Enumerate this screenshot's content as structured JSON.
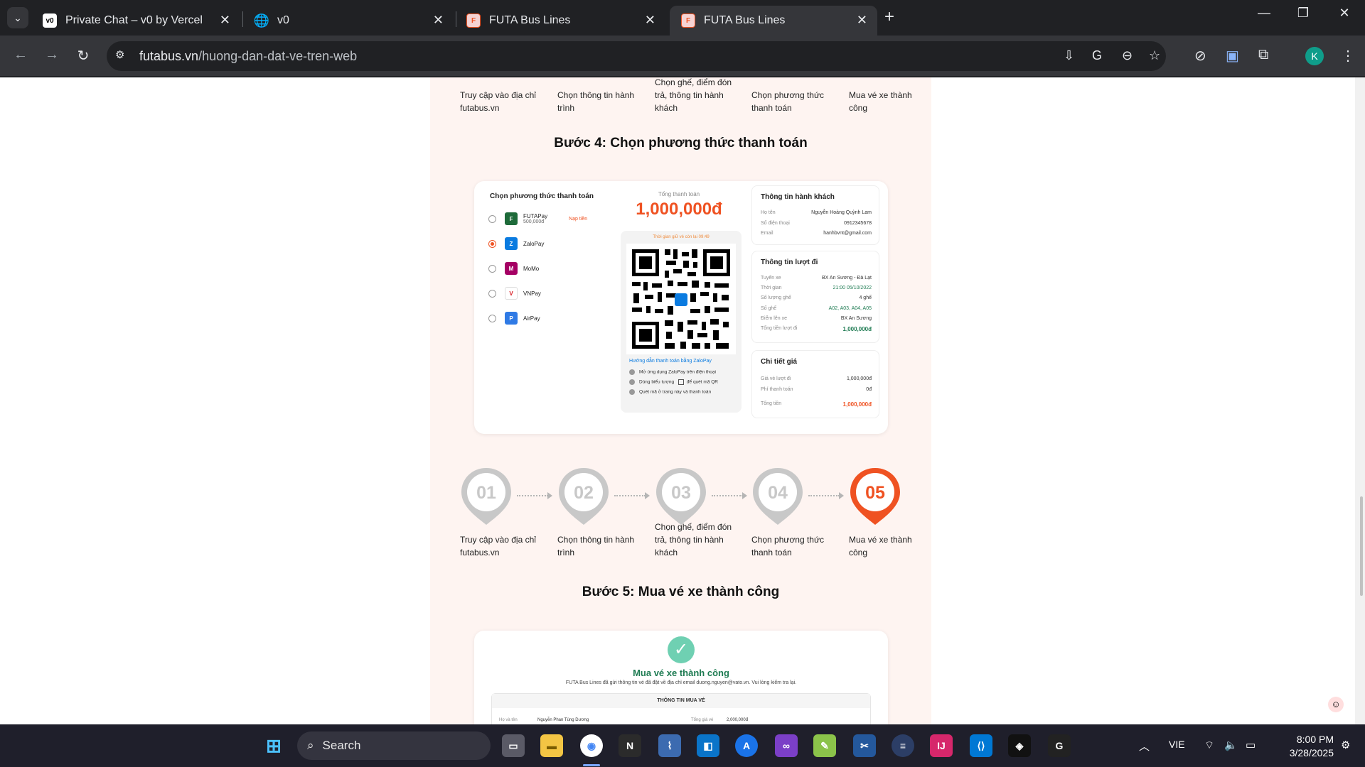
{
  "browser": {
    "tabs": [
      {
        "title": "Private Chat – v0 by Vercel",
        "favicon": "v0-icon"
      },
      {
        "title": "v0",
        "favicon": "globe-icon"
      },
      {
        "title": "FUTA Bus Lines",
        "favicon": "futa-icon"
      },
      {
        "title": "FUTA Bus Lines",
        "favicon": "futa-icon",
        "active": true
      }
    ],
    "url_host": "futabus.vn",
    "url_path": "/huong-dan-dat-ve-tren-web",
    "profile_initial": "K"
  },
  "page": {
    "top_steps": [
      {
        "label": "Truy cập vào địa chỉ futabus.vn"
      },
      {
        "label": "Chọn thông tin hành trình"
      },
      {
        "label": "Chọn ghế, điểm đón trả, thông tin hành khách"
      },
      {
        "label": "Chọn phương thức thanh toán"
      },
      {
        "label": "Mua vé xe thành công"
      }
    ],
    "step4_heading": "Bước 4: Chọn phương thức thanh toán",
    "payment": {
      "title": "Chọn phương thức thanh toán",
      "methods": [
        {
          "name": "FUTAPay",
          "sub": "500,000đ",
          "extra": "Nạp tiền",
          "color": "#1e6b3a",
          "icon": "futapay-icon",
          "selected": false
        },
        {
          "name": "ZaloPay",
          "color": "#0a7be0",
          "icon": "zalopay-icon",
          "selected": true
        },
        {
          "name": "MoMo",
          "color": "#a50064",
          "icon": "momo-icon",
          "selected": false
        },
        {
          "name": "VNPay",
          "color": "#d71920",
          "icon": "vnpay-icon",
          "selected": false
        },
        {
          "name": "AirPay",
          "color": "#2f7ae5",
          "icon": "airpay-icon",
          "selected": false
        }
      ],
      "total_label": "Tổng thanh toán",
      "total_value": "1,000,000đ",
      "countdown": "Thời gian giữ vé còn lại 09:49",
      "guide_title": "Hướng dẫn thanh toán bằng ZaloPay",
      "guide_steps": [
        "Mở ứng dụng ZaloPay trên điện thoại",
        "Dùng biểu tượng",
        "để quét mã QR",
        "Quét mã ở trang này và thanh toán"
      ],
      "passenger": {
        "title": "Thông tin hành khách",
        "rows": [
          {
            "k": "Họ tên",
            "v": "Nguyễn Hoàng Quỳnh Lam"
          },
          {
            "k": "Số điện thoại",
            "v": "0912345678"
          },
          {
            "k": "Email",
            "v": "hanhbvnt@gmail.com"
          }
        ]
      },
      "trip": {
        "title": "Thông tin lượt đi",
        "rows": [
          {
            "k": "Tuyến xe",
            "v": "BX An Sương - Đà Lạt"
          },
          {
            "k": "Thời gian",
            "v": "21:00 05/10/2022"
          },
          {
            "k": "Số lượng ghế",
            "v": "4 ghế"
          },
          {
            "k": "Số ghế",
            "v": "A02, A03, A04, A05"
          },
          {
            "k": "Điểm lên xe",
            "v": "BX An Sương"
          },
          {
            "k": "Tổng tiền lượt đi",
            "v": "1,000,000đ"
          }
        ]
      },
      "price": {
        "title": "Chi tiết giá",
        "rows": [
          {
            "k": "Giá vé lượt đi",
            "v": "1,000,000đ"
          },
          {
            "k": "Phí thanh toán",
            "v": "0đ"
          },
          {
            "k": "Tổng tiền",
            "v": "1,000,000đ"
          }
        ]
      }
    },
    "steps": [
      {
        "num": "01",
        "label": "Truy cập vào địa chỉ futabus.vn",
        "active": false
      },
      {
        "num": "02",
        "label": "Chọn thông tin hành trình",
        "active": false
      },
      {
        "num": "03",
        "label": "Chọn ghế, điểm đón trả, thông tin hành khách",
        "active": false
      },
      {
        "num": "04",
        "label": "Chọn phương thức thanh toán",
        "active": false
      },
      {
        "num": "05",
        "label": "Mua vé xe thành công",
        "active": true
      }
    ],
    "step5_heading": "Bước 5: Mua vé xe thành công",
    "success": {
      "title": "Mua vé xe thành công",
      "message": "FUTA Bus Lines đã gửi thông tin vé đã đặt về địa chỉ email duong.nguyen@vato.vn. Vui lòng kiểm tra lại.",
      "section_title": "THÔNG TIN MUA VÉ",
      "row_left_key": "Họ và tên",
      "row_left_value": "Nguyễn Phan Tùng Dương",
      "row_right_key": "Tổng giá vé",
      "row_right_value": "2,000,000đ"
    },
    "colors": {
      "accent": "#ef5222",
      "inactive_pin": "#c8c8c8",
      "success_green": "#1e7b52"
    }
  },
  "taskbar": {
    "search_placeholder": "Search",
    "language": "VIE",
    "time": "8:00 PM",
    "date": "3/28/2025"
  }
}
